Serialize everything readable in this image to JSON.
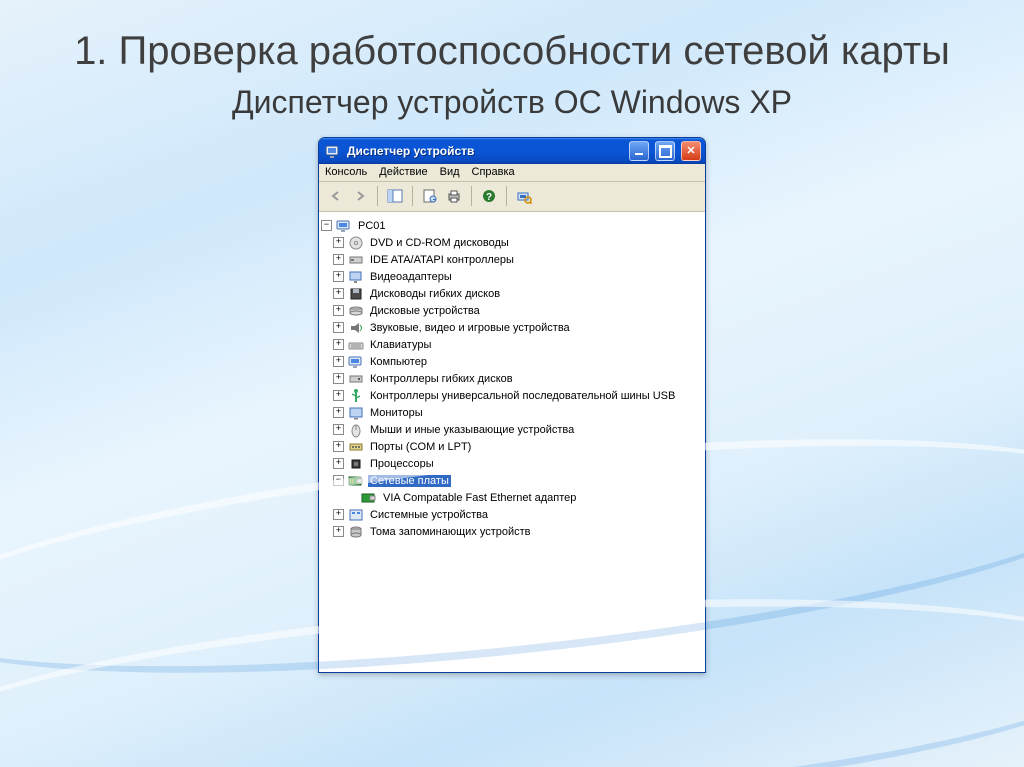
{
  "slide": {
    "title": "1. Проверка  работоспособности сетевой карты",
    "subtitle": "Диспетчер устройств ОС Windows XP"
  },
  "window": {
    "title": "Диспетчер устройств"
  },
  "menu": {
    "console": "Консоль",
    "action": "Действие",
    "view": "Вид",
    "help": "Справка"
  },
  "toolbar": {
    "back": "back",
    "forward": "forward",
    "showhide": "show-hide-tree",
    "properties": "properties",
    "print": "print",
    "help": "help",
    "refresh": "refresh"
  },
  "tree": {
    "root": "PC01",
    "items": [
      {
        "icon": "cd-icon",
        "label": "DVD и CD-ROM дисководы"
      },
      {
        "icon": "ide-icon",
        "label": "IDE ATA/ATAPI контроллеры"
      },
      {
        "icon": "display-icon",
        "label": "Видеоадаптеры"
      },
      {
        "icon": "floppy-icon",
        "label": "Дисководы гибких дисков"
      },
      {
        "icon": "disk-icon",
        "label": "Дисковые устройства"
      },
      {
        "icon": "sound-icon",
        "label": "Звуковые, видео и игровые устройства"
      },
      {
        "icon": "keyboard-icon",
        "label": "Клавиатуры"
      },
      {
        "icon": "computer-icon",
        "label": "Компьютер"
      },
      {
        "icon": "floppyctrl-icon",
        "label": "Контроллеры гибких дисков"
      },
      {
        "icon": "usb-icon",
        "label": "Контроллеры универсальной последовательной шины USB"
      },
      {
        "icon": "monitor-icon",
        "label": "Мониторы"
      },
      {
        "icon": "mouse-icon",
        "label": "Мыши и иные указывающие устройства"
      },
      {
        "icon": "port-icon",
        "label": "Порты (COM и LPT)"
      },
      {
        "icon": "cpu-icon",
        "label": "Процессоры"
      }
    ],
    "network_group": {
      "icon": "nic-group-icon",
      "label": "Сетевые платы",
      "selected": true
    },
    "network_child": {
      "icon": "nic-icon",
      "label": "VIA Compatable Fast Ethernet адаптер"
    },
    "after": [
      {
        "icon": "system-icon",
        "label": "Системные устройства"
      },
      {
        "icon": "storage-icon",
        "label": "Тома запоминающих устройств"
      }
    ]
  }
}
